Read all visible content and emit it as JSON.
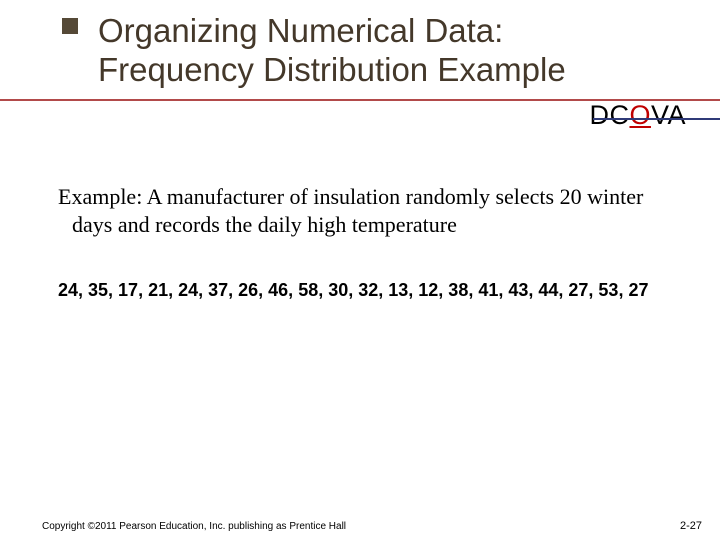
{
  "title": "Organizing Numerical Data: Frequency Distribution Example",
  "dcova": {
    "pre": "DC",
    "o": "O",
    "post": "VA"
  },
  "example_text": "Example: A manufacturer of insulation randomly selects 20 winter days and records the daily high temperature",
  "data_values": "24, 35, 17, 21, 24, 37, 26, 46, 58, 30, 32, 13, 12, 38, 41, 43, 44, 27, 53, 27",
  "copyright": "Copyright ©2011 Pearson Education, Inc. publishing as Prentice Hall",
  "page_number": "2-27"
}
